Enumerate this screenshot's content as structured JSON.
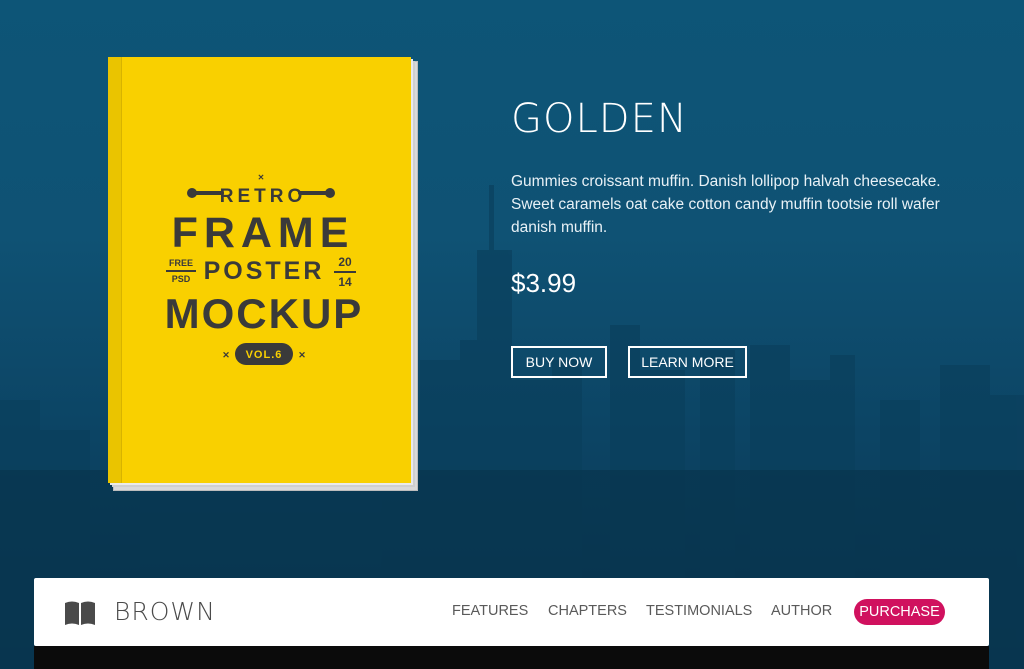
{
  "hero": {
    "title": "GOLDEN",
    "description": "Gummies croissant muffin. Danish lollipop halvah cheesecake. Sweet caramels oat cake cotton candy muffin tootsie roll wafer danish muffin.",
    "price": "$3.99",
    "buy_label": "BUY NOW",
    "learn_label": "LEARN MORE"
  },
  "book_cover": {
    "line1": "RETRO",
    "line2": "FRAME",
    "line3": "POSTER",
    "line4": "MOCKUP",
    "free": "FREE",
    "psd": "PSD",
    "year_top": "20",
    "year_bottom": "14",
    "volume": "VOL.6",
    "cover_color": "#f9d000",
    "ink_color": "#3a3a3a"
  },
  "navbar": {
    "brand": "BROWN",
    "brand_icon": "open-book-icon",
    "items": [
      {
        "label": "FEATURES"
      },
      {
        "label": "CHAPTERS"
      },
      {
        "label": "TESTIMONIALS"
      },
      {
        "label": "AUTHOR"
      }
    ],
    "cta_label": "PURCHASE",
    "cta_color": "#d0115e"
  }
}
